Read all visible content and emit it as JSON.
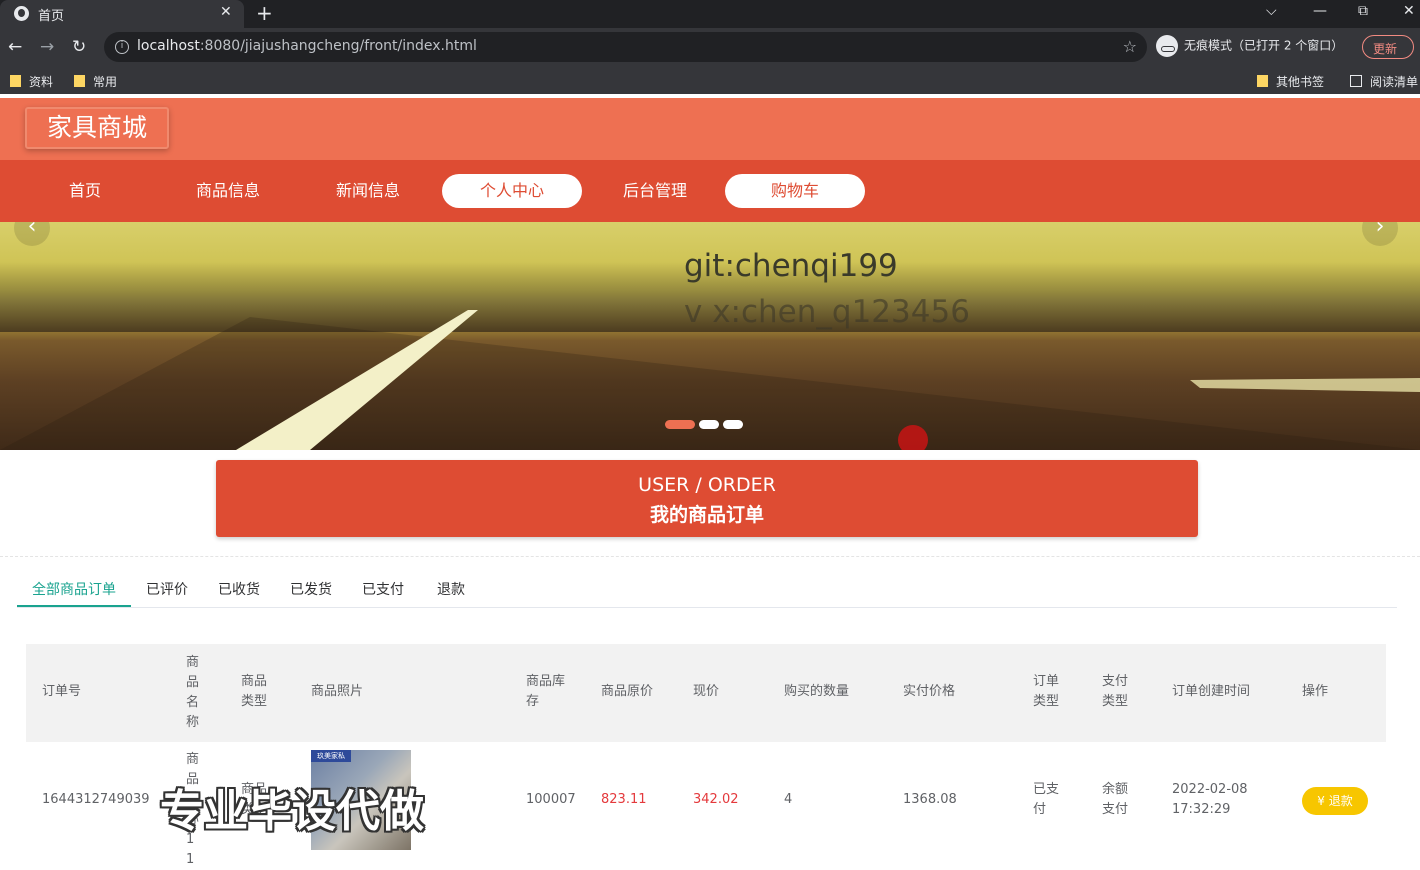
{
  "browser": {
    "tab_title": "首页",
    "tab_close": "✕",
    "new_tab": "+",
    "window_controls": [
      "⌵",
      "—",
      "⧉",
      "✕"
    ],
    "url_host": "localhost",
    "url_path": ":8080/jiajushangcheng/front/index.html",
    "incognito_label": "无痕模式（已打开 2 个窗口）",
    "update_label": "更新",
    "bookmarks_left": [
      "资料",
      "常用"
    ],
    "bookmarks_right": [
      "其他书签",
      "阅读清单"
    ]
  },
  "site": {
    "logo": "家具商城",
    "nav": [
      "首页",
      "商品信息",
      "新闻信息",
      "个人中心",
      "后台管理",
      "购物车"
    ]
  },
  "banner": {
    "caption_line1": "git:chenqi199",
    "caption_line2": "v x:chen_q123456",
    "prev": "‹",
    "next": "›"
  },
  "section": {
    "title_en": "USER / ORDER",
    "title_cn": "我的商品订单"
  },
  "order_tabs": [
    "全部商品订单",
    "已评价",
    "已收货",
    "已发货",
    "已支付",
    "退款"
  ],
  "table": {
    "headers": [
      "订单号",
      "商品名称",
      "商品类型",
      "商品照片",
      "商品库存",
      "商品原价",
      "现价",
      "购买的数量",
      "实付价格",
      "订单类型",
      "支付类型",
      "订单创建时间",
      "操作"
    ],
    "row": {
      "order_no": "1644312749039",
      "name": "商品名称11",
      "type": "商品类型",
      "photo_tag": "玖美家私",
      "stock": "100007",
      "original_price": "823.11",
      "current_price": "342.02",
      "quantity": "4",
      "paid": "1368.08",
      "order_type": "已支付",
      "pay_type": "余额支付",
      "created": "2022-02-08 17:32:29",
      "action": "退款"
    }
  },
  "watermark": "专业毕设代做",
  "colors": {
    "header": "#ee7052",
    "nav": "#de4c33",
    "tab_active": "#1aa38f",
    "price": "#e4393c",
    "refund": "#f7c600"
  }
}
